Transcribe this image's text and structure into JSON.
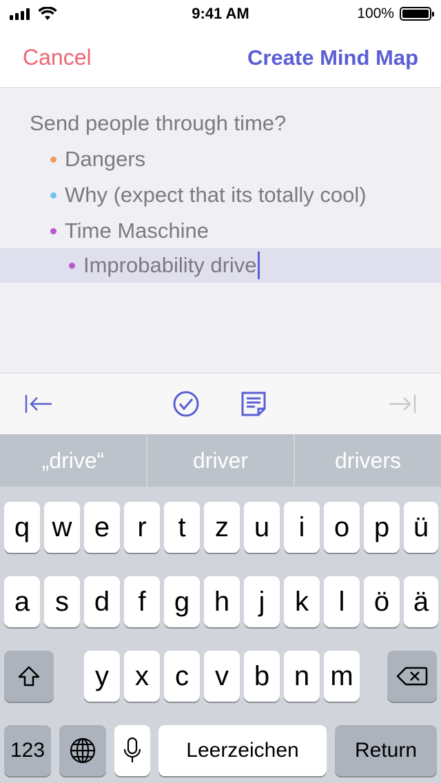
{
  "status_bar": {
    "time": "9:41 AM",
    "battery_percent": "100%",
    "icons": [
      "signal-icon",
      "wifi-icon",
      "battery-icon"
    ]
  },
  "nav": {
    "cancel_label": "Cancel",
    "create_label": "Create Mind Map",
    "cancel_color": "#ef6673",
    "create_color": "#5a5fd4"
  },
  "outline": {
    "root": "Send people through time?",
    "items": [
      {
        "text": "Dangers",
        "bullet_color": "#f39a5c"
      },
      {
        "text": "Why (expect that its totally cool)",
        "bullet_color": "#6ec6f0"
      },
      {
        "text": "Time Maschine",
        "bullet_color": "#b35cc9"
      },
      {
        "text": "Improbability drive",
        "bullet_color": "#b35cc9",
        "selected": true
      }
    ]
  },
  "toolbar": {
    "icons": [
      "outdent-icon",
      "checkmark-circle-icon",
      "note-icon",
      "indent-icon"
    ]
  },
  "suggestions": [
    "„drive“",
    "driver",
    "drivers"
  ],
  "keyboard": {
    "row1": [
      "q",
      "w",
      "e",
      "r",
      "t",
      "z",
      "u",
      "i",
      "o",
      "p",
      "ü"
    ],
    "row2": [
      "a",
      "s",
      "d",
      "f",
      "g",
      "h",
      "j",
      "k",
      "l",
      "ö",
      "ä"
    ],
    "row3": [
      "y",
      "x",
      "c",
      "v",
      "b",
      "n",
      "m"
    ],
    "numbers_label": "123",
    "space_label": "Leerzeichen",
    "return_label": "Return",
    "icons": [
      "shift-icon",
      "backspace-icon",
      "globe-icon",
      "microphone-icon"
    ]
  }
}
